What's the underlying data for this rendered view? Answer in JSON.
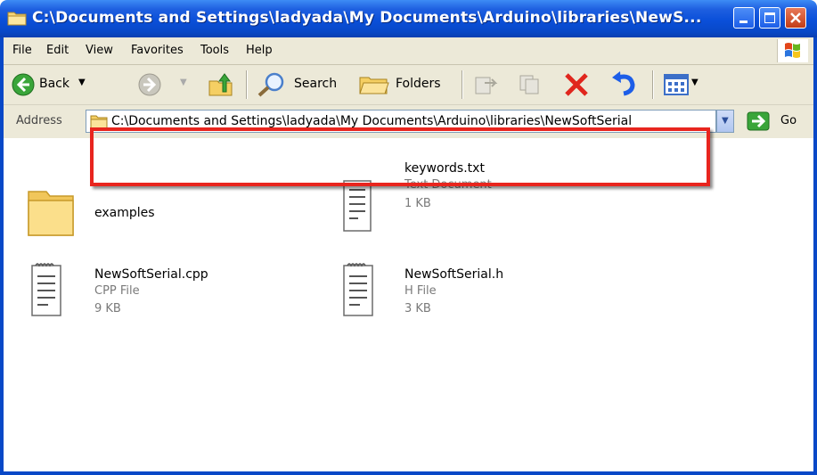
{
  "window": {
    "title": "C:\\Documents and Settings\\ladyada\\My Documents\\Arduino\\libraries\\NewS..."
  },
  "menu": [
    {
      "label": "File"
    },
    {
      "label": "Edit"
    },
    {
      "label": "View"
    },
    {
      "label": "Favorites"
    },
    {
      "label": "Tools"
    },
    {
      "label": "Help"
    }
  ],
  "toolbar": {
    "back_label": "Back",
    "search_label": "Search",
    "folders_label": "Folders"
  },
  "address": {
    "label": "Address",
    "value": "C:\\Documents and Settings\\ladyada\\My Documents\\Arduino\\libraries\\NewSoftSerial",
    "go_label": "Go"
  },
  "files": [
    {
      "name": "examples",
      "type": "",
      "size": "",
      "icon": "folder-icon"
    },
    {
      "name": "keywords.txt",
      "type": "Text Document",
      "size": "1 KB",
      "icon": "text-document-icon"
    },
    {
      "name": "NewSoftSerial.cpp",
      "type": "CPP File",
      "size": "9 KB",
      "icon": "notepad-document-icon"
    },
    {
      "name": "NewSoftSerial.h",
      "type": "H File",
      "size": "3 KB",
      "icon": "notepad-document-icon"
    }
  ],
  "colors": {
    "titlebar": "#0a4fd9",
    "highlight": "#e8251e",
    "chrome": "#ece9d8"
  }
}
